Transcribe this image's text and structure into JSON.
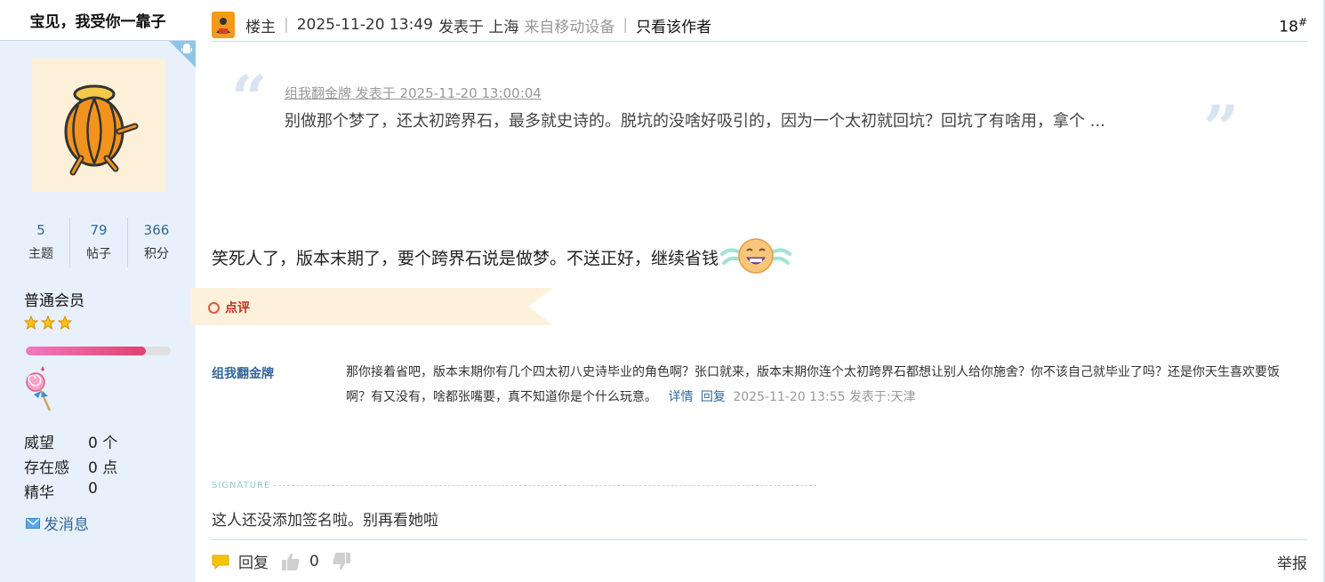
{
  "sidebar": {
    "username": "宝见，我受你一靠子",
    "stats": [
      {
        "value": "5",
        "label": "主题"
      },
      {
        "value": "79",
        "label": "帖子"
      },
      {
        "value": "366",
        "label": "积分"
      }
    ],
    "group": "普通会员",
    "star_count": 3,
    "level_progress": 0.83,
    "info": [
      {
        "key": "威望",
        "value": "0 个"
      },
      {
        "key": "存在感",
        "value": "0 点"
      },
      {
        "key": "精华",
        "value": "0"
      }
    ],
    "send_message": "发消息"
  },
  "header": {
    "role": "楼主",
    "datetime": "2025-11-20 13:49",
    "posted_in": "发表于 上海",
    "device": "来自移动设备",
    "only_author": "只看该作者",
    "floor": "18",
    "floor_mark": "#"
  },
  "quote": {
    "meta": "组我翻金牌 发表于 2025-11-20 13:00:04",
    "text": "别做那个梦了，还太初跨界石，最多就史诗的。脱坑的没啥好吸引的，因为一个太初就回坑？回坑了有啥用，拿个 ..."
  },
  "post": {
    "body": "笑死人了，版本末期了，要个跨界石说是做梦。不送正好，继续省钱"
  },
  "comments": {
    "label": "点评",
    "items": [
      {
        "author": "组我翻金牌",
        "text": "那你接着省吧，版本末期你有几个四太初八史诗毕业的角色啊？张口就来，版本末期你连个太初跨界石都想让别人给你施舍？你不该自己就毕业了吗？还是你天生喜欢要饭啊？有又没有，啥都张嘴要，真不知道你是个什么玩意。",
        "detail": "详情",
        "reply": "回复",
        "time": "2025-11-20 13:55 发表于:天津"
      }
    ]
  },
  "signature": {
    "label": "SIGNATURE",
    "text": "这人还没添加签名啦。别再看她啦"
  },
  "footer": {
    "reply": "回复",
    "likes": "0",
    "report": "举报"
  },
  "colors": {
    "sidebar_bg": "#e8f1fb",
    "link": "#336699",
    "comment_band": "#fdf1dc",
    "progress_start": "#f07ac2",
    "progress_end": "#e0426e"
  }
}
